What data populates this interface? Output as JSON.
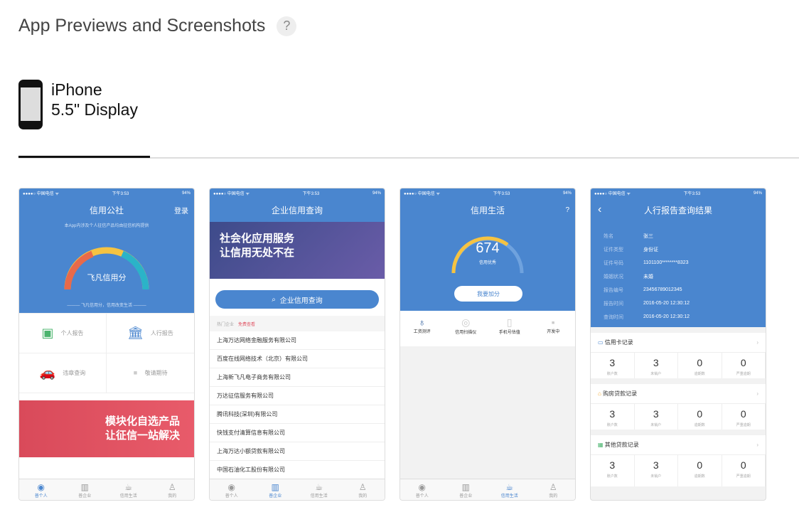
{
  "header": {
    "title": "App Previews and Screenshots",
    "help": "?"
  },
  "device": {
    "line1": "iPhone",
    "line2": "5.5\" Display"
  },
  "statusbar": {
    "carrier": "●●●●○ 中国电信 ᯤ",
    "time": "下午3:53",
    "battery": "94%"
  },
  "tabbar": [
    "普个人",
    "普企业",
    "信用生活",
    "我的"
  ],
  "shot1": {
    "title": "信用公社",
    "login": "登录",
    "subtitle": "本App内涉及个人征信产品均由征信机构提供",
    "gauge_label": "飞凡信用分",
    "gauge_caption": "——— 飞凡信用分，信用改变生活 ———",
    "items": [
      "个人报告",
      "人行报告",
      "违章查询",
      "敬请期待"
    ],
    "banner_line1": "模块化自选产品",
    "banner_line2": "让征信一站解决"
  },
  "shot2": {
    "title": "企业信用查询",
    "banner_line1": "社会化应用服务",
    "banner_line2": "让信用无处不在",
    "search_label": "企业信用查询",
    "section_label": "热门企业",
    "section_tag": "免费查看",
    "companies": [
      "上海万达网络金融服务有限公司",
      "百度在线网络技术（北京）有限公司",
      "上海新飞凡电子商务有限公司",
      "万达征信服务有限公司",
      "腾讯科技(深圳)有限公司",
      "快钱支付清算信息有限公司",
      "上海万达小额贷款有限公司",
      "中国石油化工股份有限公司"
    ]
  },
  "shot3": {
    "title": "信用生活",
    "score": "674",
    "score_label": "信用优秀",
    "button": "我要加分",
    "items": [
      "工资测评",
      "信用扫描仪",
      "手机号估值",
      "开发中"
    ]
  },
  "shot4": {
    "title": "人行报告查询结果",
    "details": [
      {
        "k": "姓名",
        "v": "张三"
      },
      {
        "k": "证件类型",
        "v": "身份证"
      },
      {
        "k": "证件号码",
        "v": "1101100********8323"
      },
      {
        "k": "婚姻状况",
        "v": "未婚"
      },
      {
        "k": "报告编号",
        "v": "23456789012345"
      },
      {
        "k": "报告时间",
        "v": "2016-05-20  12:30:12"
      },
      {
        "k": "查询时间",
        "v": "2016-05-20  12:30:12"
      }
    ],
    "sections": [
      {
        "title": "信用卡记录",
        "values": [
          "3",
          "3",
          "0",
          "0"
        ]
      },
      {
        "title": "购房贷款记录",
        "values": [
          "3",
          "3",
          "0",
          "0"
        ]
      },
      {
        "title": "其他贷款记录",
        "values": [
          "3",
          "3",
          "0",
          "0"
        ]
      }
    ],
    "stat_labels": [
      "账户数",
      "未销户",
      "逾期数",
      "严重逾期"
    ]
  },
  "colors": {
    "brand_blue": "#4a86cf",
    "banner_red": "#e05565"
  }
}
